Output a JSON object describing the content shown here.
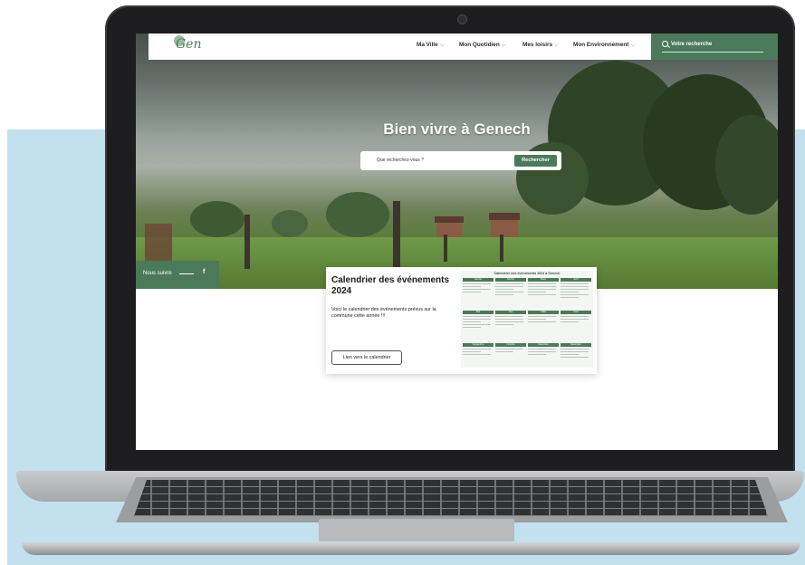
{
  "navbar": {
    "logo_text": "Gen",
    "items": [
      {
        "label": "Ma Ville"
      },
      {
        "label": "Mon Quotidien"
      },
      {
        "label": "Mes loisirs"
      },
      {
        "label": "Mon Environnement"
      }
    ],
    "search_label": "Votre recherche"
  },
  "hero": {
    "title": "Bien vivre à Genech",
    "search_placeholder": "Que recherchez-vous ?",
    "search_button": "Rechercher"
  },
  "follow": {
    "label": "Nous suivre",
    "facebook": "f"
  },
  "card": {
    "title": "Calendrier des événements 2024",
    "description": "Voici le calendrier des événements prévus sur la commune cette année !!!",
    "button": "Lien vers le calendrier",
    "calendar_title": "Calendrier des événements 2024 à Genech",
    "months": [
      "Janvier",
      "Février",
      "Mars",
      "Avril",
      "Mai",
      "Juin",
      "Juillet",
      "Août",
      "Septembre",
      "Octobre",
      "Novembre",
      "Décembre"
    ]
  },
  "colors": {
    "accent": "#4b7a5a",
    "background_block": "#c3e0ee"
  }
}
